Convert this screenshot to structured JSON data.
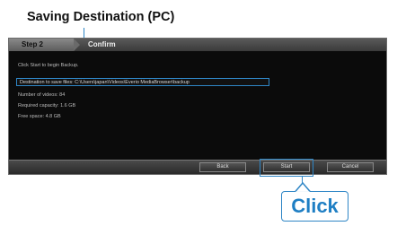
{
  "heading": "Saving Destination (PC)",
  "window": {
    "step_label": "Step 2",
    "title": "Confirm",
    "lines": [
      "Click Start to begin Backup.",
      "Number of videos: 84",
      "Required capacity: 1.6 GB",
      "Free space: 4.8 GB"
    ],
    "destination": "Destination to save files: C:\\Users\\japan\\Videos\\Everio MediaBrowser\\backup"
  },
  "buttons": {
    "back": "Back",
    "start": "Start",
    "cancel": "Cancel"
  },
  "callout": "Click",
  "colors": {
    "accent": "#2f86c6",
    "callout_text": "#1f7fc4"
  }
}
